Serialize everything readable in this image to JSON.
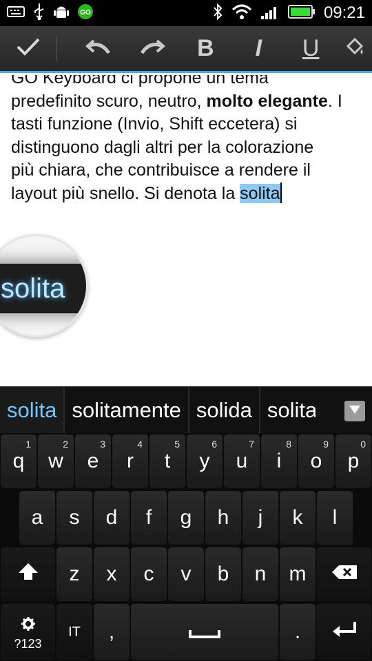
{
  "status_bar": {
    "time": "09:21",
    "left_icons": [
      "keyboard-icon",
      "usb-icon",
      "android-debug-icon",
      "go-keyboard-icon"
    ],
    "right_icons": [
      "bluetooth-icon",
      "wifi-icon",
      "signal-icon",
      "battery-icon"
    ]
  },
  "toolbar": {
    "buttons": [
      "check-icon",
      "undo-icon",
      "redo-icon",
      "bold-icon",
      "italic-icon",
      "underline-icon",
      "fill-color-icon"
    ],
    "bold_label": "B",
    "italic_label": "I",
    "underline_label": "U"
  },
  "document": {
    "line1": "GO Keyboard ci propone un tema",
    "line2_before": "predefinito scuro, neutro, ",
    "line2_bold": "molto elegante",
    "line2_after": ". I",
    "line3": "tasti funzione (Invio, Shift eccetera) si",
    "line4": "distinguono dagli altri per la colorazione",
    "line5": "più chiara, che contribuisce a rendere il",
    "line6_before": "layout più snello. Si denota la ",
    "line6_selected": "solita"
  },
  "magnifier": {
    "text": "solita"
  },
  "suggestions": {
    "items": [
      "solita",
      "solitamente",
      "solida",
      "solita"
    ],
    "active_index": 0
  },
  "keyboard": {
    "row1": [
      {
        "k": "q",
        "h": "1"
      },
      {
        "k": "w",
        "h": "2"
      },
      {
        "k": "e",
        "h": "3"
      },
      {
        "k": "r",
        "h": "4"
      },
      {
        "k": "t",
        "h": "5"
      },
      {
        "k": "y",
        "h": "6"
      },
      {
        "k": "u",
        "h": "7"
      },
      {
        "k": "i",
        "h": "8"
      },
      {
        "k": "o",
        "h": "9"
      },
      {
        "k": "p",
        "h": "0"
      }
    ],
    "row2": [
      "a",
      "s",
      "d",
      "f",
      "g",
      "h",
      "j",
      "k",
      "l"
    ],
    "row3": [
      "z",
      "x",
      "c",
      "v",
      "b",
      "n",
      "m"
    ],
    "symbols_label": "?123",
    "lang_label": "IT",
    "comma_label": ",",
    "period_label": ".",
    "icons": [
      "shift-icon",
      "backspace-icon",
      "settings-icon",
      "space-icon",
      "enter-icon"
    ]
  },
  "colors": {
    "accent": "#4aa8e8",
    "selection": "#8ec9f4",
    "suggest_active": "#6ec9ff"
  }
}
